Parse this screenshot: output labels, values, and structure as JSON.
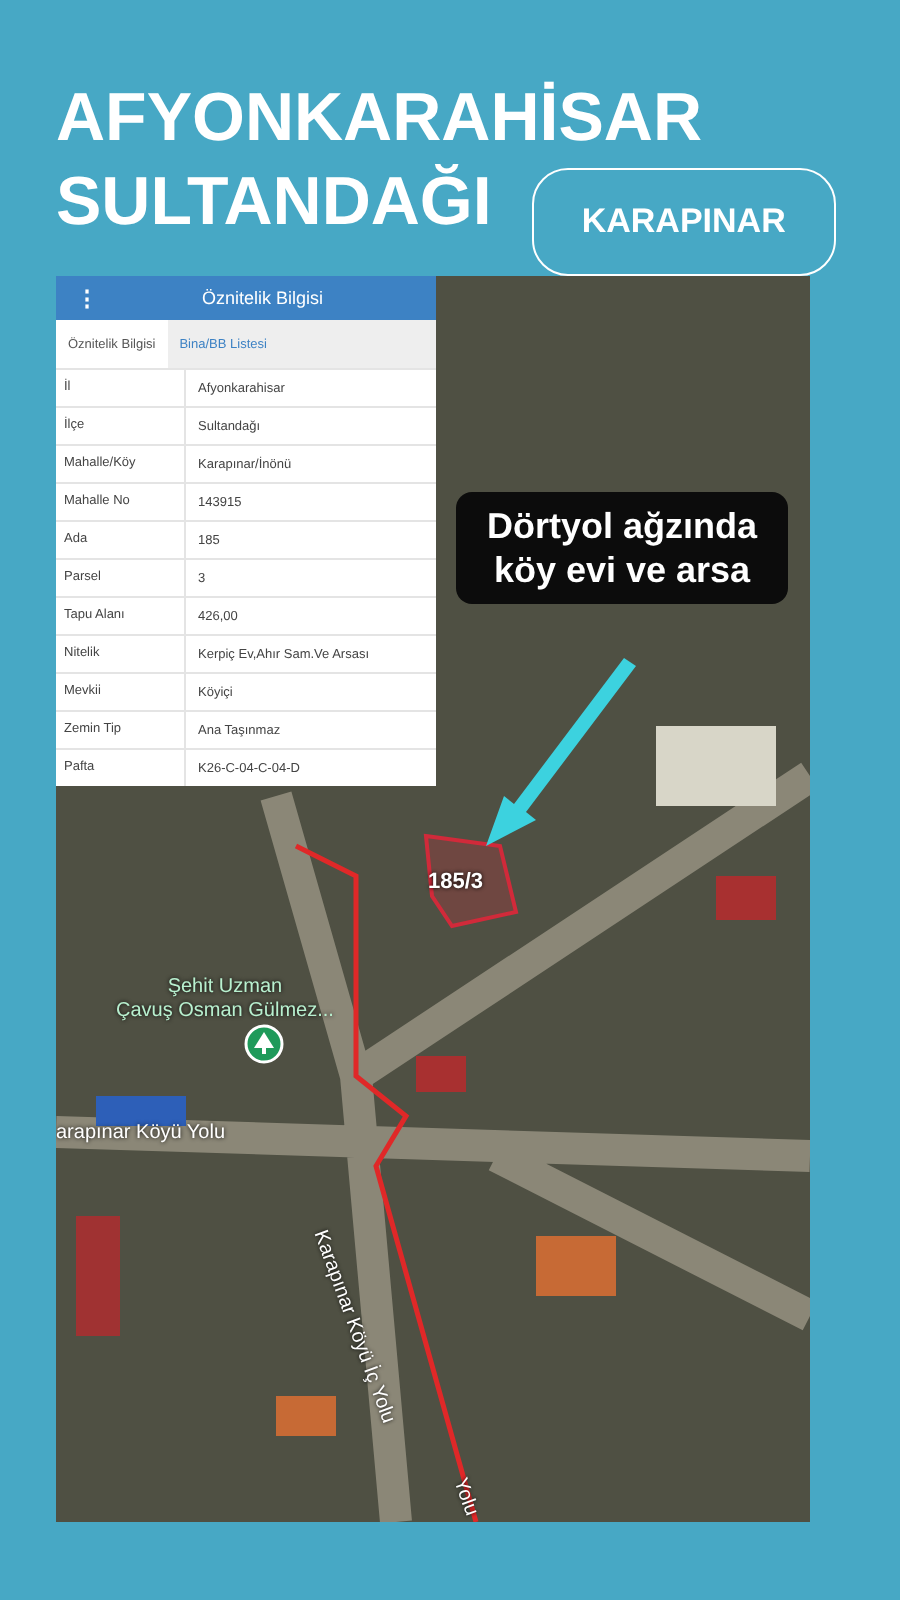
{
  "title_lines": [
    "AFYONKARAHİSAR",
    "SULTANDAĞI"
  ],
  "location_button": "KARAPINAR",
  "info_panel": {
    "title": "Öznitelik Bilgisi",
    "menu_icon": "⋮",
    "tabs": [
      {
        "label": "Öznitelik Bilgisi",
        "selected": true
      },
      {
        "label": "Bina/BB Listesi",
        "selected": false
      }
    ],
    "rows": [
      {
        "label": "İl",
        "value": "Afyonkarahisar"
      },
      {
        "label": "İlçe",
        "value": "Sultandağı"
      },
      {
        "label": "Mahalle/Köy",
        "value": "Karapınar/İnönü"
      },
      {
        "label": "Mahalle No",
        "value": "143915"
      },
      {
        "label": "Ada",
        "value": "185"
      },
      {
        "label": "Parsel",
        "value": "3"
      },
      {
        "label": "Tapu Alanı",
        "value": "426,00"
      },
      {
        "label": "Nitelik",
        "value": "Kerpiç Ev,Ahır Sam.Ve Arsası"
      },
      {
        "label": "Mevkii",
        "value": "Köyiçi"
      },
      {
        "label": "Zemin Tip",
        "value": "Ana Taşınmaz"
      },
      {
        "label": "Pafta",
        "value": "K26-C-04-C-04-D"
      }
    ]
  },
  "callout": "Dörtyol ağzında köy evi ve arsa",
  "parcel_label": "185/3",
  "map_labels": {
    "poi_lines": [
      "Şehit Uzman",
      "Çavuş Osman Gülmez..."
    ],
    "road_1": "arapınar Köyü Yolu",
    "road_2": "Karapınar Köyü İç Yolu",
    "road_2_tail": "Yolu"
  }
}
